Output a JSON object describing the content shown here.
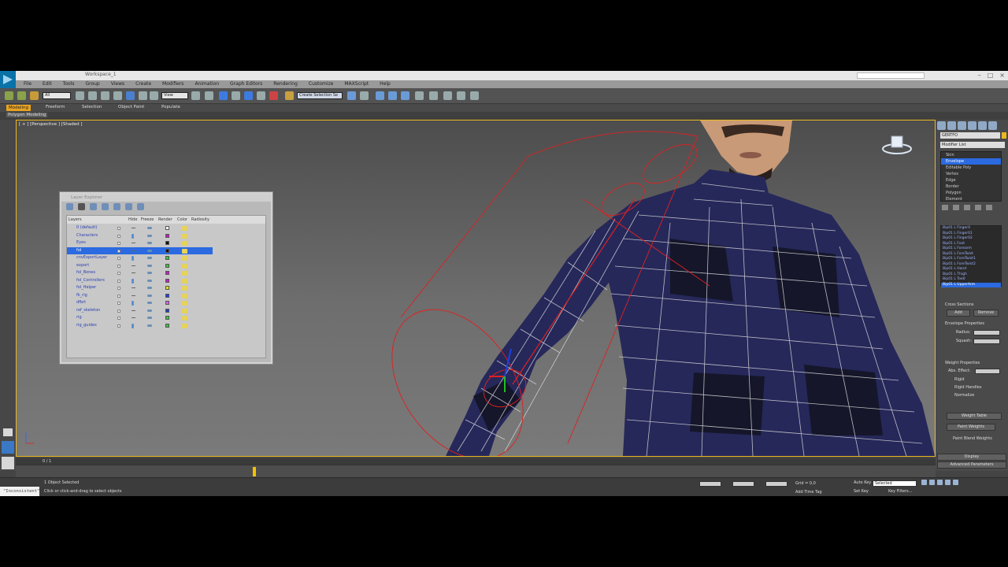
{
  "window": {
    "title": "Workspace_1",
    "colors": {
      "accent": "#e9b820",
      "selection": "#2b6ae0",
      "active_tab": "#e9a320"
    }
  },
  "menubar": [
    "File",
    "Edit",
    "Tools",
    "Group",
    "Views",
    "Create",
    "Modifiers",
    "Animation",
    "Graph Editors",
    "Rendering",
    "Customize",
    "MAXScript",
    "Help"
  ],
  "toolbar": {
    "filter_select": "All",
    "view_select": "View",
    "selection_set": "Create Selection Se"
  },
  "ribbon": {
    "tabs": [
      "Modeling",
      "Freeform",
      "Selection",
      "Object Paint",
      "Populate"
    ],
    "subpanel": "Polygon Modeling"
  },
  "viewport": {
    "label": "[ + ] [Perspective ] [Shaded ]"
  },
  "layer_explorer": {
    "title": "Layer Explorer",
    "columns": [
      "Layers",
      "Hide",
      "Freeze",
      "Render",
      "Color",
      "Radiosity"
    ],
    "rows": [
      {
        "name": "0 (default)",
        "color": "#ffffff"
      },
      {
        "name": "Characters",
        "color": "#c020c0"
      },
      {
        "name": "Eyes",
        "color": "#101010"
      },
      {
        "name": "fol",
        "color": "#101010",
        "selected": true
      },
      {
        "name": "cnvExportLayer",
        "color": "#40c040"
      },
      {
        "name": "export",
        "color": "#40c040"
      },
      {
        "name": "fol_Bones",
        "color": "#c020c0"
      },
      {
        "name": "fol_Controllers",
        "color": "#c020c0"
      },
      {
        "name": "fol_Helper",
        "color": "#e0e020"
      },
      {
        "name": "fk_rig",
        "color": "#2040e0"
      },
      {
        "name": "dfbrt",
        "color": "#e060e0"
      },
      {
        "name": "ref_skeleton",
        "color": "#2040c0"
      },
      {
        "name": "rig",
        "color": "#40c040"
      },
      {
        "name": "rig_guides",
        "color": "#40c040"
      }
    ]
  },
  "command_panel": {
    "object_name": "GERTFO",
    "modifier_list_label": "Modifier List",
    "stack": [
      "Skin",
      "Envelope",
      "Editable Poly",
      "Vertex",
      "Edge",
      "Border",
      "Polygon",
      "Element"
    ],
    "stack_selected": 1,
    "bones": [
      "Bip01 L Finger0",
      "Bip01 L Finger01",
      "Bip01 L Finger02",
      "Bip01 L Foot",
      "Bip01 L Forearm",
      "Bip01 L ForeTwist",
      "Bip01 L ForeTwist1",
      "Bip01 L ForeTwist2",
      "Bip01 L Hand",
      "Bip01 L Thigh",
      "Bip01 L Toe0",
      "Bip01 L UpperArm"
    ],
    "bones_selected": 11,
    "cross_sections": "Cross Sections",
    "add": "Add",
    "remove": "Remove",
    "envelope_properties": "Envelope Properties",
    "radius_label": "Radius:",
    "squash_label": "Squash:",
    "weight_properties": "Weight Properties",
    "abs_effect": "Abs. Effect:",
    "rigid": "Rigid",
    "rigid_handles": "Rigid Handles",
    "normalize": "Normalize",
    "weight_table": "Weight Table",
    "paint_weights": "Paint Weights",
    "paint_blend_weights": "Paint Blend Weights",
    "display": "Display",
    "advanced_parameters": "Advanced Parameters"
  },
  "timeline": {
    "frame_readout": "0 / 1"
  },
  "status": {
    "maxscript_text": "\"Inconsistent\"",
    "selection_info": "1 Object Selected",
    "prompt": "Click or click-and-drag to select objects",
    "grid": "Grid = 0,0",
    "add_time_tag": "Add Time Tag",
    "auto_key": "Auto Key",
    "set_key": "Set Key",
    "key_filters": "Key Filters...",
    "selected": "Selected"
  }
}
